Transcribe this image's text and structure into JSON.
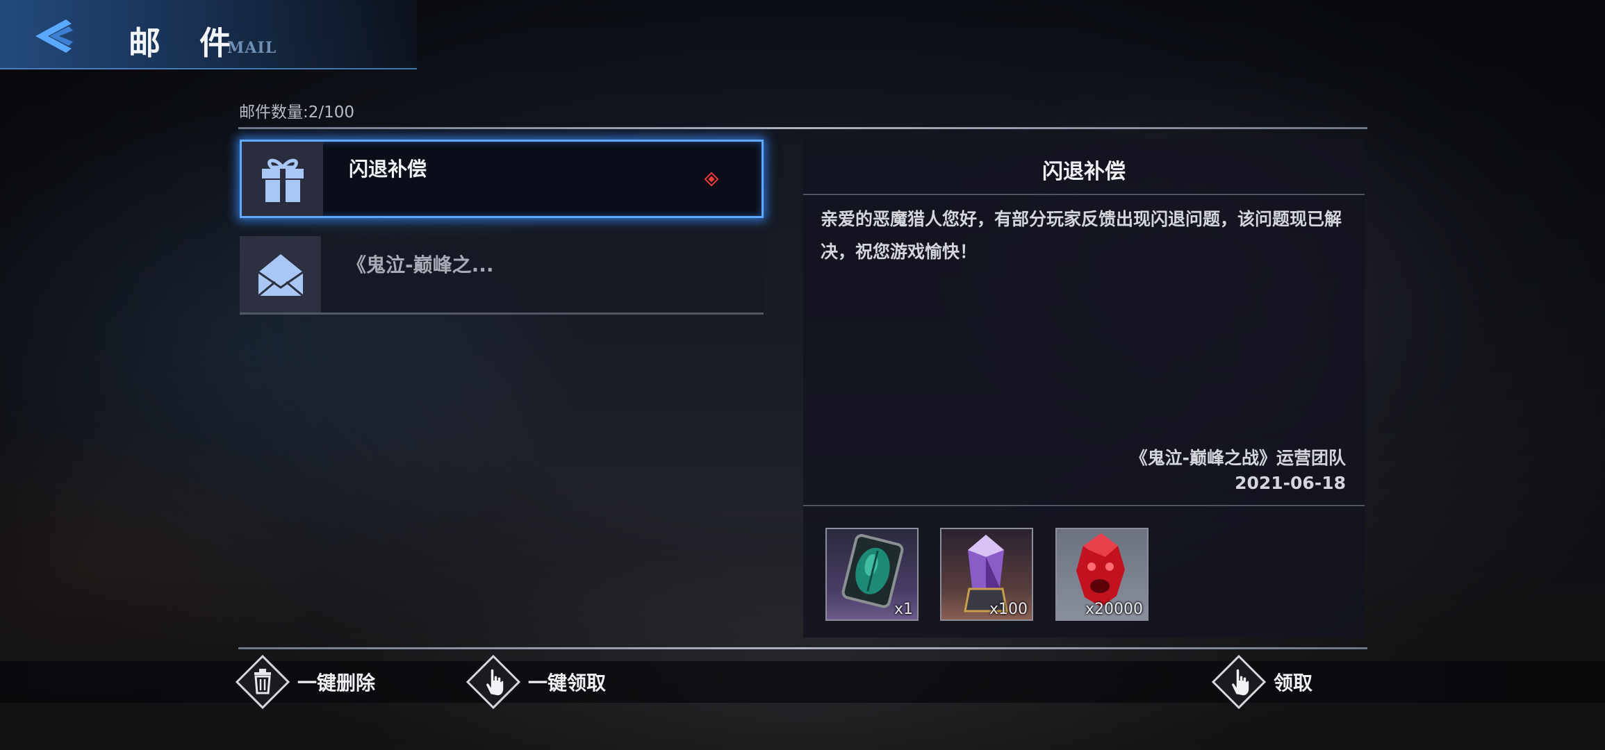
{
  "header": {
    "title_cn": "邮 件",
    "title_en": "MAIL",
    "back_icon": "back-arrow-icon"
  },
  "mail_count": "邮件数量:2/100",
  "mail_list": [
    {
      "title": "闪退补偿",
      "icon": "gift-icon",
      "selected": true,
      "unread": true
    },
    {
      "title": "《鬼泣-巅峰之...",
      "icon": "envelope-icon",
      "selected": false,
      "unread": false
    }
  ],
  "detail": {
    "title": "闪退补偿",
    "body": "亲爱的恶魔猎人您好，有部分玩家反馈出现闪退问题，该问题现已解决，祝您游戏愉快！",
    "signature": "《鬼泣-巅峰之战》运营团队",
    "date": "2021-06-18",
    "rewards": [
      {
        "icon": "green-armor-card-icon",
        "qty": "x1"
      },
      {
        "icon": "purple-crystal-icon",
        "qty": "x100"
      },
      {
        "icon": "red-orb-icon",
        "qty": "x20000"
      }
    ]
  },
  "actions": {
    "delete_all": "一键删除",
    "claim_all": "一键领取",
    "claim": "领取"
  },
  "colors": {
    "accent_blue": "#5fa9ff",
    "new_marker_red": "#ff3b3b"
  }
}
